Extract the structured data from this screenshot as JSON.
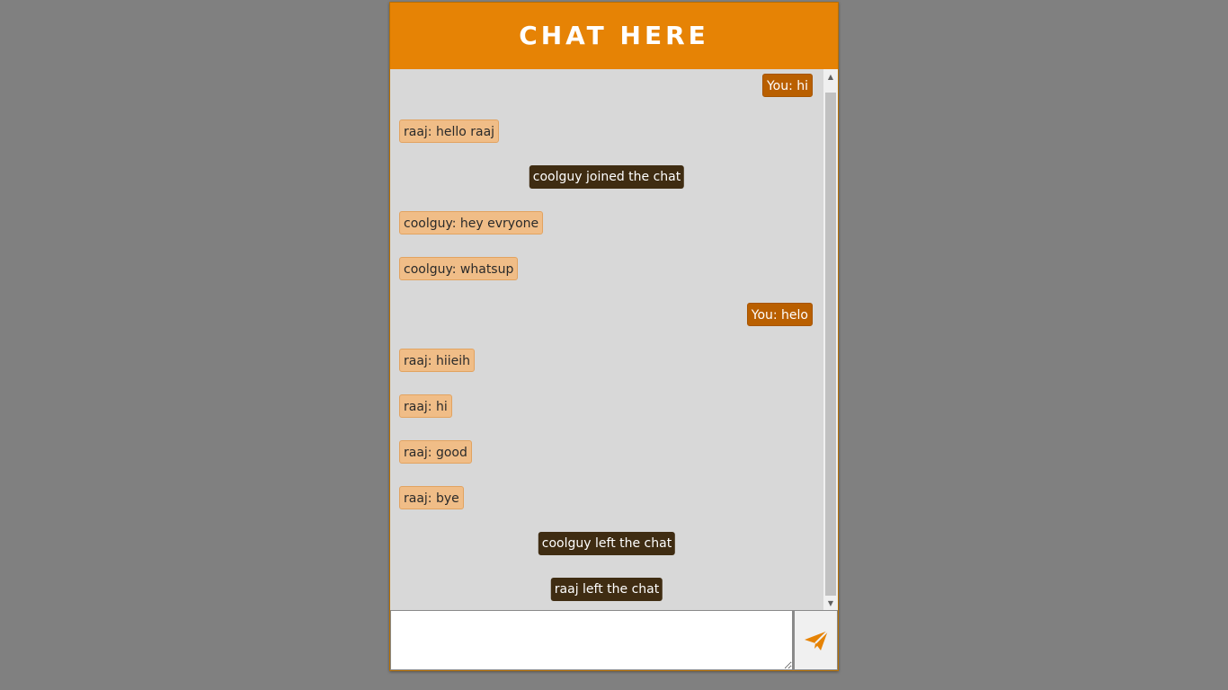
{
  "header": {
    "title": "CHAT HERE"
  },
  "messages": [
    {
      "kind": "out",
      "text": "You: hi"
    },
    {
      "kind": "in",
      "text": "raaj: hello raaj"
    },
    {
      "kind": "sys",
      "text": "coolguy joined the chat"
    },
    {
      "kind": "in",
      "text": "coolguy: hey evryone"
    },
    {
      "kind": "in",
      "text": "coolguy: whatsup"
    },
    {
      "kind": "out",
      "text": "You: helo"
    },
    {
      "kind": "in",
      "text": "raaj: hiieih"
    },
    {
      "kind": "in",
      "text": "raaj: hi"
    },
    {
      "kind": "in",
      "text": "raaj: good"
    },
    {
      "kind": "in",
      "text": "raaj: bye"
    },
    {
      "kind": "sys",
      "text": "coolguy left the chat"
    },
    {
      "kind": "sys",
      "text": "raaj left the chat"
    }
  ],
  "composer": {
    "input_value": "",
    "send_icon": "paper-plane-icon"
  },
  "colors": {
    "header_bg": "#e68305",
    "outgoing_bg": "#b95f00",
    "incoming_bg": "#f0bd87",
    "system_bg": "#3f2c12",
    "chat_bg": "#d8d8d8",
    "page_bg": "#808080",
    "send_icon": "#e68305"
  }
}
